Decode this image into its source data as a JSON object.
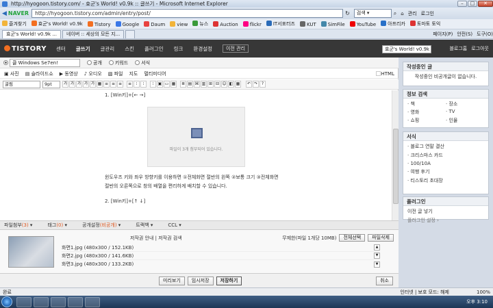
{
  "window": {
    "title": "http://hyogoon.tistory.com/ - 효군's World! v0.9k :: 글쓰기 - Microsoft Internet Explorer",
    "min": "–",
    "max": "□",
    "close": "✕"
  },
  "addressbar": {
    "naver": "NAVER",
    "url": "http://hyogoon.tistory.com/admin/entry/post/",
    "search_label": "검색",
    "manage": "관리",
    "login": "로그인"
  },
  "favorites": [
    {
      "label": "즐겨찾기",
      "color": "#f2b43a"
    },
    {
      "label": "효군's World! v0.9k",
      "color": "#f36f21"
    },
    {
      "label": "Tistory",
      "color": "#f36f21"
    },
    {
      "label": "Google",
      "color": "#3b78e7"
    },
    {
      "label": "Daum",
      "color": "#e8423f"
    },
    {
      "label": "view",
      "color": "#f2b43a"
    },
    {
      "label": "뉴스",
      "color": "#3a9a3a"
    },
    {
      "label": "Auction",
      "color": "#d33"
    },
    {
      "label": "flickr",
      "color": "#ff0084"
    },
    {
      "label": "IT서포터즈",
      "color": "#2a6bb8"
    },
    {
      "label": "KUT",
      "color": "#666"
    },
    {
      "label": "SimFile",
      "color": "#48a"
    },
    {
      "label": "YouTube",
      "color": "#e00"
    },
    {
      "label": "아프리카",
      "color": "#2870c8"
    },
    {
      "label": "토마토 토익",
      "color": "#d33"
    }
  ],
  "tabs": [
    {
      "label": "효군's World! v0.9k ..."
    },
    {
      "label": "네이버 :: 세상의 모든 지..."
    }
  ],
  "tab_tools": {
    "page": "페이지(P)",
    "safety": "안전(S)",
    "tools": "도구(O)"
  },
  "tistory": {
    "logo": "TISTORY",
    "nav": [
      "센터",
      "글쓰기",
      "글관리",
      "스킨",
      "플러그인",
      "링크",
      "환경설정"
    ],
    "prev_manage": "이전 관리",
    "blog_select": "효군's World! v0.9k",
    "blog_home": "블로그홈",
    "logout": "로그아웃"
  },
  "editor": {
    "category": "클  Windows Se7en!",
    "visibility": [
      "공개",
      "키워드",
      "서식"
    ],
    "media": [
      "사진",
      "슬라이드쇼",
      "동영상",
      "오디오",
      "파일",
      "지도",
      "멀티미디어"
    ],
    "html_label": "HTML",
    "font": "굴림",
    "size": "9pt",
    "tools": [
      "가",
      "가",
      "가",
      "가",
      "가"
    ],
    "line1": "1. [Win키]+[← →]",
    "image_caption": "파일이 3개 첨부되어 있습니다.",
    "para1": "윈도우즈 키와 좌우 방향키를 이용하면 ①전체화면 절반의 왼쪽 ②보통 크기 ③전체화면",
    "para2": "절반의 오른쪽으로 창의 배열을 편리하게 배치할 수 있습니다.",
    "line2": "2. [Win키]+[↑ ↓]"
  },
  "attach": {
    "tabs": [
      {
        "label": "파일첨부",
        "count": "(3)"
      },
      {
        "label": "태그",
        "count": "(0)"
      },
      {
        "label": "공개설정",
        "count": "(비공개)"
      },
      {
        "label": "트랙백",
        "count": ""
      },
      {
        "label": "CCL",
        "count": ""
      }
    ],
    "info": "저작권 안내 | 저작권 검색",
    "quota": "무제한(파일 1개당 10MB)",
    "select_all": "전체선택",
    "delete_file": "파일삭제",
    "files": [
      "화면1.jpg (480x300 / 152.1KB)",
      "화면2.jpg (480x300 / 141.6KB)",
      "화면3.jpg (480x300 / 133.2KB)"
    ],
    "buttons": {
      "preview": "미리보기",
      "temp": "임시저장",
      "save": "저장하기",
      "cancel": "취소"
    }
  },
  "sidebar": {
    "draft": {
      "title": "작성중인 글",
      "body": "작성중인 비공개글이 없습니다."
    },
    "info": {
      "title": "정보 검색",
      "items": [
        "책",
        "장소",
        "영화",
        "TV",
        "쇼핑",
        "인물"
      ]
    },
    "template": {
      "title": "서식",
      "items": [
        "블로그 연말 결산",
        "크리스마스 카드",
        "100/10A",
        "여행 후기",
        "티스토리 초대장"
      ]
    },
    "plugin": {
      "title": "플러그인",
      "items": [
        "이전 글 넣기",
        "플러그인 설정 ›"
      ]
    }
  },
  "status": {
    "left": "완료",
    "zone": "인터넷 | 보호 모드: 해제",
    "zoom": "100%"
  },
  "taskbar": {
    "clock": "오후 3:10"
  }
}
